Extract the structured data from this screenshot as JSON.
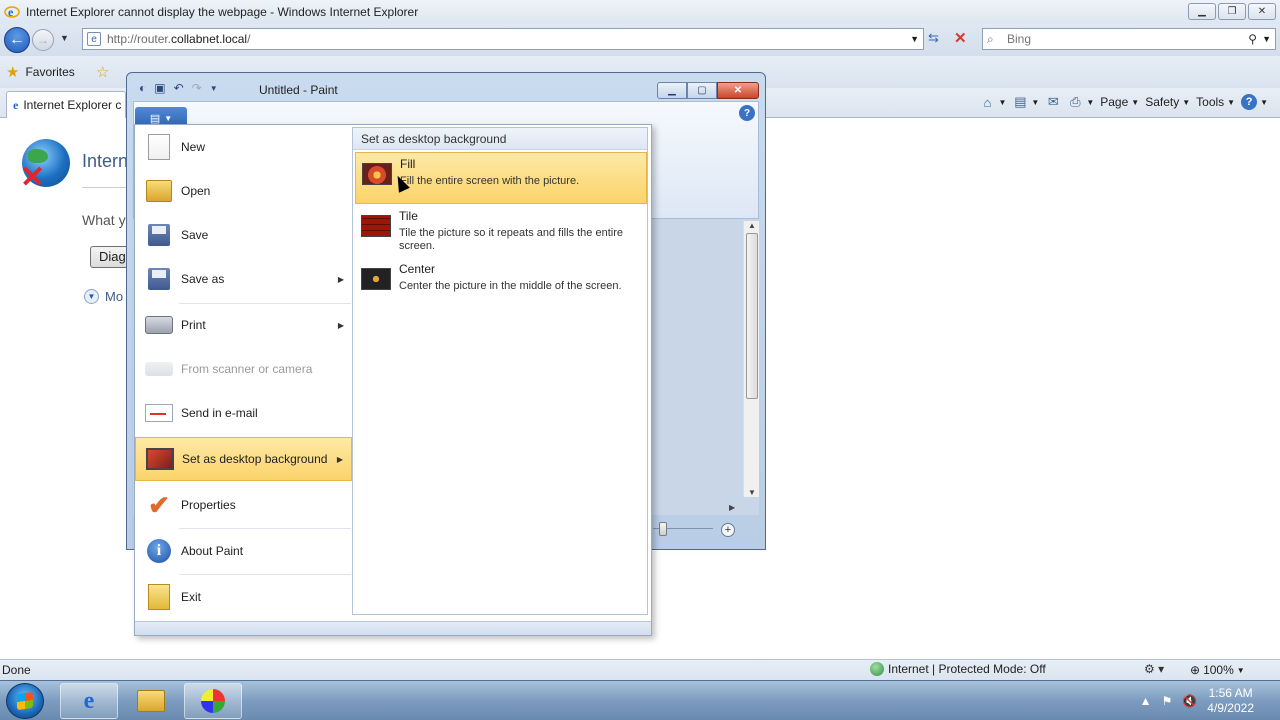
{
  "ie": {
    "title": "Internet Explorer cannot display the webpage - Windows Internet Explorer",
    "address": {
      "url_prefix": "http://router.",
      "url_host": "collabnet.local",
      "url_suffix": "/"
    },
    "search_placeholder": "Bing",
    "favorites_label": "Favorites",
    "tab_label": "Internet Explorer c",
    "commands": {
      "page": "Page",
      "safety": "Safety",
      "tools": "Tools"
    },
    "content": {
      "heading": "Intern",
      "body_text": "What y",
      "diagnose_button": "Diag",
      "more_info": "Mo"
    },
    "status": {
      "text": "Done",
      "zone": "Internet | Protected Mode: Off",
      "zoom": "100%"
    }
  },
  "paint": {
    "title": "Untitled - Paint",
    "app_menu": {
      "items": [
        {
          "label": "New",
          "icon": "new-page-icon"
        },
        {
          "label": "Open",
          "icon": "open-folder-icon"
        },
        {
          "label": "Save",
          "icon": "save-disk-icon"
        },
        {
          "label": "Save as",
          "icon": "save-as-icon"
        },
        {
          "label": "Print",
          "icon": "printer-icon"
        },
        {
          "label": "From scanner or camera",
          "icon": "scanner-icon"
        },
        {
          "label": "Send in e-mail",
          "icon": "email-icon"
        },
        {
          "label": "Set as desktop background",
          "icon": "desktop-background-icon"
        },
        {
          "label": "Properties",
          "icon": "properties-check-icon"
        },
        {
          "label": "About Paint",
          "icon": "info-icon"
        },
        {
          "label": "Exit",
          "icon": "exit-icon"
        }
      ],
      "submenu": {
        "header": "Set as desktop background",
        "items": [
          {
            "title": "Fill",
            "desc": "Fill the entire screen with the picture."
          },
          {
            "title": "Tile",
            "desc": "Tile the picture so it repeats and fills the entire screen."
          },
          {
            "title": "Center",
            "desc": "Center the picture in the middle of the screen."
          }
        ]
      }
    }
  },
  "taskbar": {
    "time": "1:56 AM",
    "date": "4/9/2022"
  }
}
